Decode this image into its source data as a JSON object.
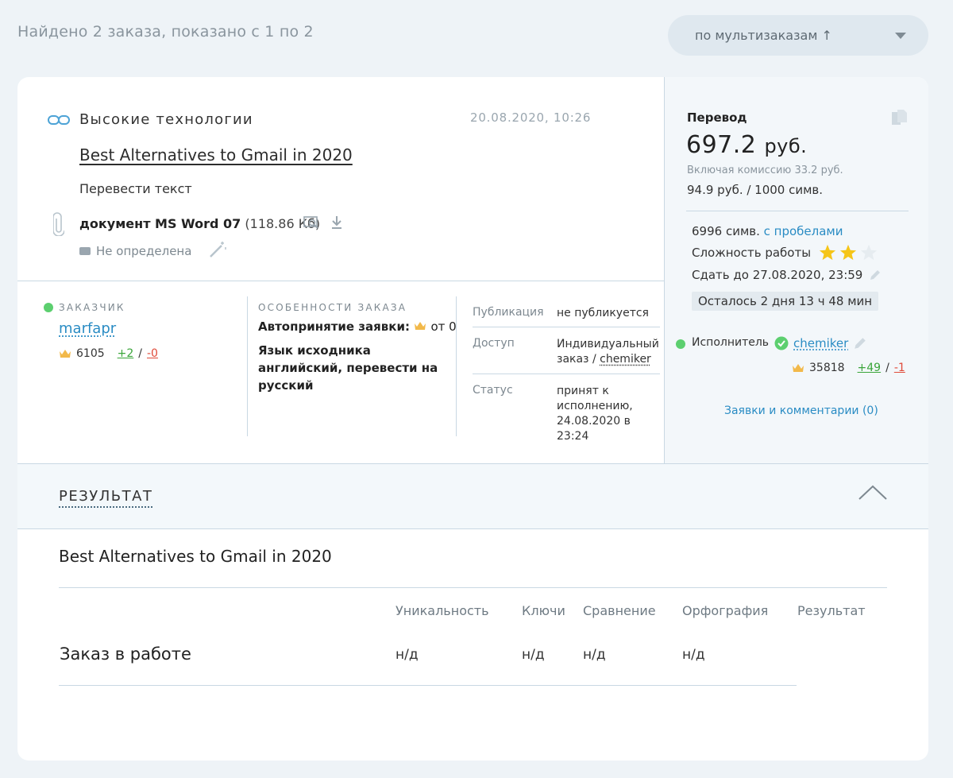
{
  "header": {
    "found_text": "Найдено 2 заказа, показано с 1 по 2",
    "sort_label": "по мультизаказам ↑"
  },
  "order": {
    "category": "Высокие технологии",
    "date": "20.08.2020, 10:26",
    "title": "Best Alternatives to Gmail in 2020",
    "task": "Перевести текст",
    "doc_name": "документ MS Word 07",
    "doc_size": "(118.86 Кб)",
    "topic": "Не определена"
  },
  "customer": {
    "label": "ЗАКАЗЧИК",
    "name": "marfapr",
    "rating": "6105",
    "plus": "+2",
    "sep": "/",
    "minus": "-0"
  },
  "features": {
    "label": "ОСОБЕННОСТИ ЗАКАЗА",
    "auto_accept": "Автопринятие заявки:",
    "auto_accept_value": "от 0",
    "language": "Язык исходника английский, перевести на русский"
  },
  "meta": {
    "publication_key": "Публикация",
    "publication_val": "не публикуется",
    "access_key": "Доступ",
    "access_val": "Индивидуальный заказ /",
    "access_user": "chemiker",
    "status_key": "Статус",
    "status_val": "принят к исполнению, 24.08.2020 в 23:24"
  },
  "pricing": {
    "type": "Перевод",
    "price": "697.2",
    "currency": "руб.",
    "commission": "Включая комиссию 33.2 руб.",
    "rate": "94.9 руб. / 1000 симв.",
    "chars": "6996 симв.",
    "chars_link": "с пробелами",
    "difficulty_label": "Сложность работы",
    "difficulty_stars": 2,
    "difficulty_max": 3,
    "deadline": "Сдать до 27.08.2020, 23:59",
    "time_left": "Осталось 2 дня 13 ч 48 мин"
  },
  "executor": {
    "label": "Исполнитель",
    "name": "chemiker",
    "rating": "35818",
    "plus": "+49",
    "sep": "/",
    "minus": "-1",
    "bids_link": "Заявки и комментарии (0)"
  },
  "result": {
    "section_title": "РЕЗУЛЬТАТ",
    "doc_title": "Best Alternatives to Gmail in 2020",
    "columns": [
      "Уникальность",
      "Ключи",
      "Сравнение",
      "Орфография",
      "Результат"
    ],
    "row_label": "Заказ в работе",
    "values": [
      "н/д",
      "н/д",
      "н/д",
      "н/д"
    ]
  },
  "colors": {
    "link": "#2a8cc4",
    "online": "#5ccf6f",
    "positive": "#3aa53a",
    "negative": "#e04b3a",
    "star": "#f5c518"
  }
}
